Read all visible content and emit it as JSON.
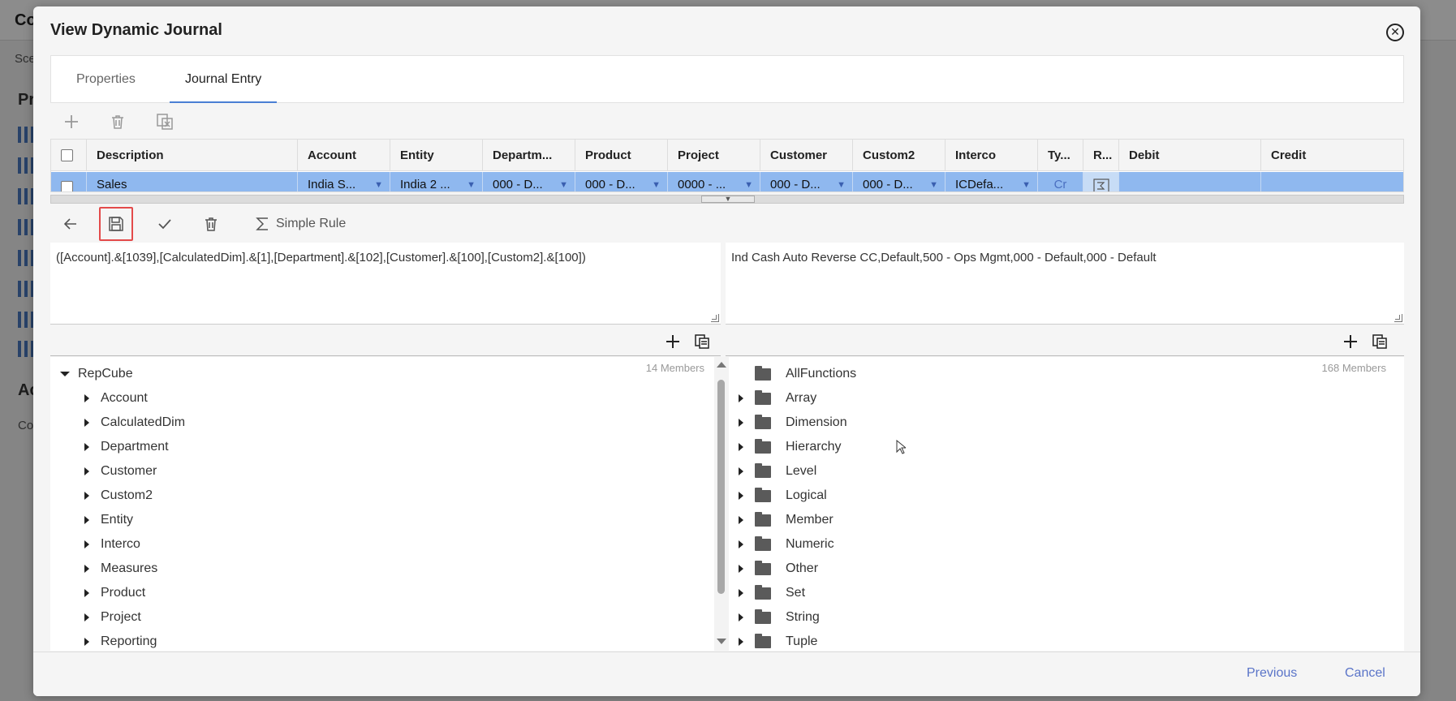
{
  "background": {
    "title": "Co",
    "subtitle": "Sce",
    "section1": "Pr",
    "section2": "Ac",
    "sub2": "Co"
  },
  "dialog": {
    "title": "View Dynamic Journal",
    "tabs": [
      "Properties",
      "Journal Entry"
    ],
    "active_tab": "Journal Entry"
  },
  "grid": {
    "columns": [
      "Description",
      "Account",
      "Entity",
      "Departm...",
      "Product",
      "Project",
      "Customer",
      "Custom2",
      "Interco",
      "Ty...",
      "R...",
      "Debit",
      "Credit"
    ],
    "row": {
      "description": "Sales",
      "account": "India S...",
      "entity": "India 2 ...",
      "department": "000 - D...",
      "product": "000 - D...",
      "project": "0000 - ...",
      "customer": "000 - D...",
      "custom2": "000 - D...",
      "interco": "ICDefa...",
      "type": "Cr"
    }
  },
  "editor": {
    "simple_rule_label": "Simple Rule",
    "expression": "([Account].&[1039],[CalculatedDim].&[1],[Department].&[102],[Customer].&[100],[Custom2].&[100])",
    "description": "Ind Cash Auto Reverse CC,Default,500 - Ops Mgmt,000 - Default,000 - Default"
  },
  "left_tree": {
    "members": "14 Members",
    "root": "RepCube",
    "items": [
      "Account",
      "CalculatedDim",
      "Department",
      "Customer",
      "Custom2",
      "Entity",
      "Interco",
      "Measures",
      "Product",
      "Project",
      "Reporting"
    ]
  },
  "right_tree": {
    "members": "168 Members",
    "root": "AllFunctions",
    "items": [
      "Array",
      "Dimension",
      "Hierarchy",
      "Level",
      "Logical",
      "Member",
      "Numeric",
      "Other",
      "Set",
      "String",
      "Tuple"
    ]
  },
  "footer": {
    "previous": "Previous",
    "cancel": "Cancel"
  },
  "colors": {
    "selected_row": "#8fb8ef",
    "link": "#5a74c8",
    "save_highlight": "#e34a4a",
    "active_tab_underline": "#4a7fd4"
  }
}
